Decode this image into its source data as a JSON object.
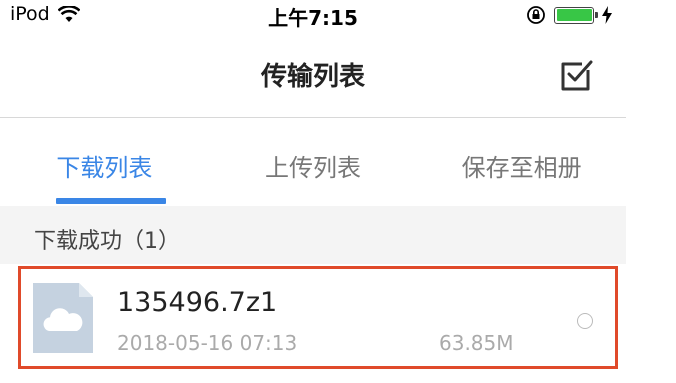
{
  "status_bar": {
    "carrier": "iPod",
    "time": "上午7:15",
    "icons": [
      "wifi-icon",
      "orientation-lock-icon",
      "battery-icon",
      "charging-icon"
    ],
    "battery_color": "#38c646"
  },
  "nav": {
    "title": "传输列表",
    "select_icon": "checkbox-icon"
  },
  "tabs": [
    {
      "label": "下载列表",
      "active": true
    },
    {
      "label": "上传列表",
      "active": false
    },
    {
      "label": "保存至相册",
      "active": false
    }
  ],
  "accent_color": "#3a86e6",
  "section": {
    "title": "下载成功（1）"
  },
  "files": [
    {
      "name": "135496.7z1",
      "date": "2018-05-16 07:13",
      "size": "63.85M",
      "icon": "cloud-file-icon"
    }
  ],
  "highlight_color": "#e04a2a"
}
